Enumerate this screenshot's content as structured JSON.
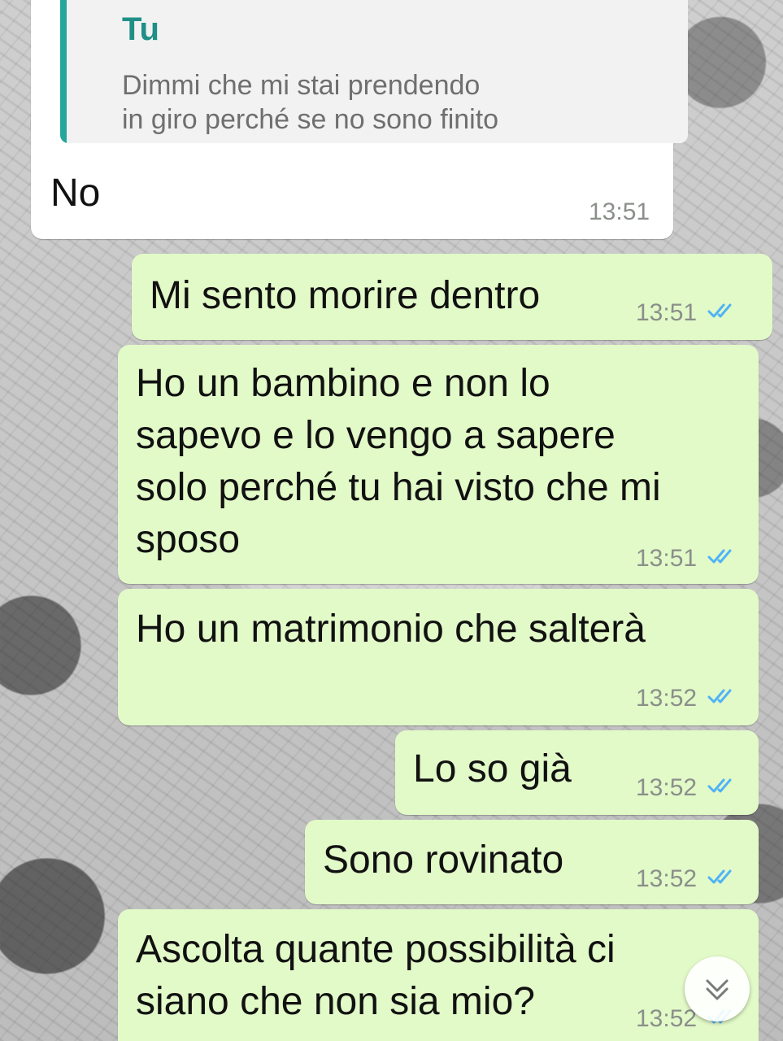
{
  "incoming": {
    "quote_author": "Tu",
    "quote_text_line1": "Dimmi che mi stai prendendo",
    "quote_text_line2": "in giro perché se no sono finito",
    "text": "No",
    "time": "13:51"
  },
  "outgoing": [
    {
      "lines": [
        "Mi sento morire dentro"
      ],
      "time": "13:51",
      "status": "read"
    },
    {
      "lines": [
        "Ho un bambino e non lo",
        "sapevo e lo vengo a sapere",
        "solo perché tu hai visto che mi",
        "sposo"
      ],
      "time": "13:51",
      "status": "read"
    },
    {
      "lines": [
        "Ho un matrimonio che salterà"
      ],
      "time": "13:52",
      "status": "read"
    },
    {
      "lines": [
        "Lo so già"
      ],
      "time": "13:52",
      "status": "read"
    },
    {
      "lines": [
        "Sono rovinato"
      ],
      "time": "13:52",
      "status": "read"
    },
    {
      "lines": [
        "Ascolta quante possibilità ci",
        "siano che non sia mio?"
      ],
      "time": "13:52",
      "status": "read"
    }
  ],
  "icons": {
    "read_receipt": "double-check-icon",
    "scroll_down": "double-chevron-down-icon"
  },
  "colors": {
    "outgoing_bubble": "#e2f9c8",
    "incoming_bubble": "#ffffff",
    "quote_accent": "#26a69a",
    "read_ticks": "#4fb3f6"
  }
}
